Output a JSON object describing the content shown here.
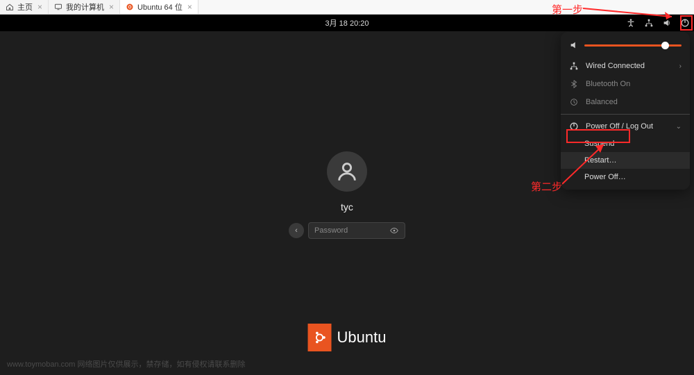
{
  "host_tabs": {
    "home": "主页",
    "computer": "我的计算机",
    "ubuntu": "Ubuntu 64 位"
  },
  "topbar": {
    "datetime": "3月 18  20:20"
  },
  "login": {
    "username": "tyc",
    "password_placeholder": "Password"
  },
  "sysmenu": {
    "wired": "Wired Connected",
    "bluetooth": "Bluetooth On",
    "balanced": "Balanced",
    "power_section": "Power Off / Log Out",
    "suspend": "Suspend",
    "restart": "Restart…",
    "poweroff": "Power Off…"
  },
  "brand": {
    "name": "Ubuntu"
  },
  "annotations": {
    "step1": "第一步",
    "step2": "第二步"
  },
  "watermark": "www.toymoban.com 网络图片仅供展示，禁存储，如有侵权请联系删除",
  "colors": {
    "accent": "#e95420",
    "anno": "#ff2a2a"
  }
}
